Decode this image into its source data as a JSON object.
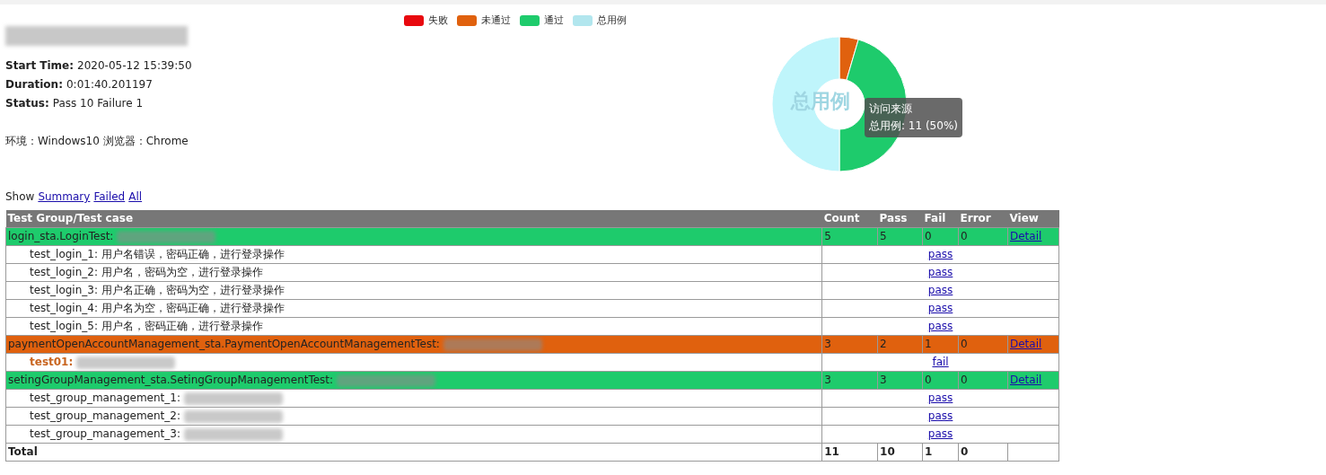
{
  "legend": [
    {
      "color": "#e8090f"
    },
    {
      "color": "#e0610e"
    },
    {
      "color": "#1ecb6c"
    },
    {
      "color": "#b2e6ee"
    }
  ],
  "summary": {
    "fields": [
      {
        "label": "Start Time:",
        "value": "2020-05-12 15:39:50"
      },
      {
        "label": "Duration:",
        "value": "0:01:40.201197"
      },
      {
        "label": "Status:",
        "value": "Pass 10 Failure 1"
      }
    ],
    "environment": "环境：Windows10 浏览器：Chrome"
  },
  "chart": {
    "center_label": "总用例",
    "tooltip": {
      "title": "访问来源",
      "text": "总用例: 11 (50%)"
    },
    "chart_data": {
      "type": "donut",
      "categories": [
        "失败",
        "未通过",
        "通过",
        "总用例"
      ],
      "values": [
        0,
        4.55,
        45.45,
        50
      ]
    }
  },
  "show": {
    "label": "Show",
    "links": [
      "Summary",
      "Failed",
      "All"
    ]
  },
  "table": {
    "columns": [
      "Test Group/Test case",
      "Count",
      "Pass",
      "Fail",
      "Error",
      "View"
    ],
    "rows": [
      {
        "kind": "group",
        "name": "login_sta.LoginTest:",
        "redacted": true,
        "color": "#1ecb6c",
        "count": "5",
        "pass": "5",
        "fail": "0",
        "error": "0",
        "view": "Detail"
      },
      {
        "kind": "case",
        "name": "test_login_1: 用户名错误，密码正确，进行登录操作",
        "failed": false,
        "redacted": false,
        "result": "pass"
      },
      {
        "kind": "case",
        "name": "test_login_2: 用户名，密码为空，进行登录操作",
        "failed": false,
        "redacted": false,
        "result": "pass"
      },
      {
        "kind": "case",
        "name": "test_login_3: 用户名正确，密码为空，进行登录操作",
        "failed": false,
        "redacted": false,
        "result": "pass"
      },
      {
        "kind": "case",
        "name": "test_login_4: 用户名为空，密码正确，进行登录操作",
        "failed": false,
        "redacted": false,
        "result": "pass"
      },
      {
        "kind": "case",
        "name": "test_login_5: 用户名，密码正确，进行登录操作",
        "failed": false,
        "redacted": false,
        "result": "pass"
      },
      {
        "kind": "group",
        "name": "paymentOpenAccountManagement_sta.PaymentOpenAccountManagementTest:",
        "redacted": true,
        "color": "#e0610e",
        "count": "3",
        "pass": "2",
        "fail": "1",
        "error": "0",
        "view": "Detail"
      },
      {
        "kind": "case",
        "name": "test01:",
        "failed": true,
        "redacted": true,
        "result": "fail"
      },
      {
        "kind": "group",
        "name": "setingGroupManagement_sta.SetingGroupManagementTest:",
        "redacted": true,
        "color": "#1ecb6c",
        "count": "3",
        "pass": "3",
        "fail": "0",
        "error": "0",
        "view": "Detail"
      },
      {
        "kind": "case",
        "name": "test_group_management_1:",
        "failed": false,
        "redacted": true,
        "result": "pass"
      },
      {
        "kind": "case",
        "name": "test_group_management_2:",
        "failed": false,
        "redacted": true,
        "result": "pass"
      },
      {
        "kind": "case",
        "name": "test_group_management_3:",
        "failed": false,
        "redacted": true,
        "result": "pass"
      },
      {
        "kind": "total",
        "name": "Total",
        "count": "11",
        "pass": "10",
        "fail": "1",
        "error": "0"
      }
    ]
  }
}
